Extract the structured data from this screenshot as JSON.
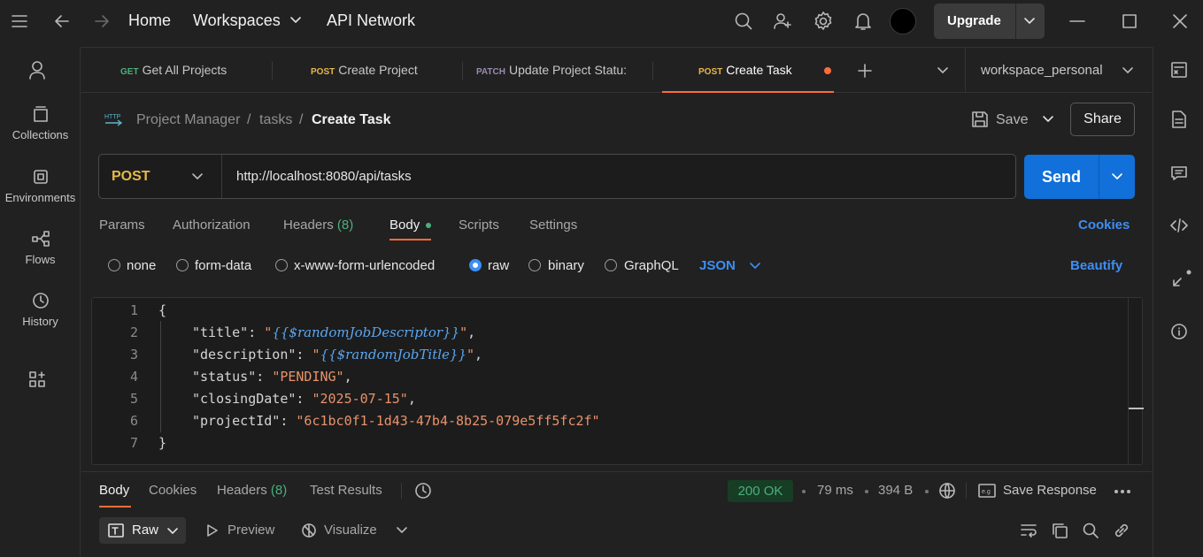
{
  "topbar": {
    "home": "Home",
    "workspaces": "Workspaces",
    "api_network": "API Network",
    "upgrade": "Upgrade"
  },
  "leftrail": {
    "items": [
      {
        "label": "Collections",
        "icon": "collections-icon"
      },
      {
        "label": "Environments",
        "icon": "environments-icon"
      },
      {
        "label": "Flows",
        "icon": "flows-icon"
      },
      {
        "label": "History",
        "icon": "history-icon"
      }
    ]
  },
  "tabs": [
    {
      "method": "GET",
      "name": "Get All Projects",
      "color": "#4caf7d"
    },
    {
      "method": "POST",
      "name": "Create Project",
      "color": "#e6b84a"
    },
    {
      "method": "PATCH",
      "name": "Update Project Statu:",
      "color": "#9a8ab0"
    },
    {
      "method": "POST",
      "name": "Create Task",
      "color": "#e6b84a"
    }
  ],
  "workspace_selector": "workspace_personal",
  "breadcrumb": {
    "collection": "Project Manager",
    "folder": "tasks",
    "request": "Create Task",
    "sep": "/"
  },
  "actions": {
    "save": "Save",
    "share": "Share"
  },
  "request": {
    "method": "POST",
    "url": "http://localhost:8080/api/tasks",
    "send": "Send"
  },
  "request_tabs": {
    "params": "Params",
    "authorization": "Authorization",
    "headers": "Headers",
    "headers_count": "(8)",
    "body": "Body",
    "scripts": "Scripts",
    "settings": "Settings",
    "cookies": "Cookies"
  },
  "body_options": {
    "none": "none",
    "form_data": "form-data",
    "urlencoded": "x-www-form-urlencoded",
    "raw": "raw",
    "binary": "binary",
    "graphql": "GraphQL",
    "format": "JSON",
    "beautify": "Beautify",
    "selected": "raw"
  },
  "editor": {
    "line_numbers": [
      "1",
      "2",
      "3",
      "4",
      "5",
      "6",
      "7"
    ],
    "open_brace": "{",
    "close_brace": "}",
    "fields": [
      {
        "key": "\"title\"",
        "value": "{{$randomJobDescriptor}}",
        "is_var": true
      },
      {
        "key": "\"description\"",
        "value": "{{$randomJobTitle}}",
        "is_var": true
      },
      {
        "key": "\"status\"",
        "value": "\"PENDING\"",
        "is_var": false
      },
      {
        "key": "\"closingDate\"",
        "value": "\"2025-07-15\"",
        "is_var": false
      },
      {
        "key": "\"projectId\"",
        "value": "\"6c1bc0f1-1d43-47b4-8b25-079e5ff5fc2f\"",
        "is_var": false
      }
    ]
  },
  "response": {
    "body": "Body",
    "cookies": "Cookies",
    "headers": "Headers",
    "headers_count": "(8)",
    "test_results": "Test Results",
    "status": "200 OK",
    "time": "79 ms",
    "size": "394 B",
    "save_response": "Save Response",
    "raw": "Raw",
    "preview": "Preview",
    "visualize": "Visualize"
  },
  "colors": {
    "accent": "#ff6c37",
    "send": "#1170d9",
    "link": "#3d8ef5",
    "status_ok": "#4caf7d"
  }
}
